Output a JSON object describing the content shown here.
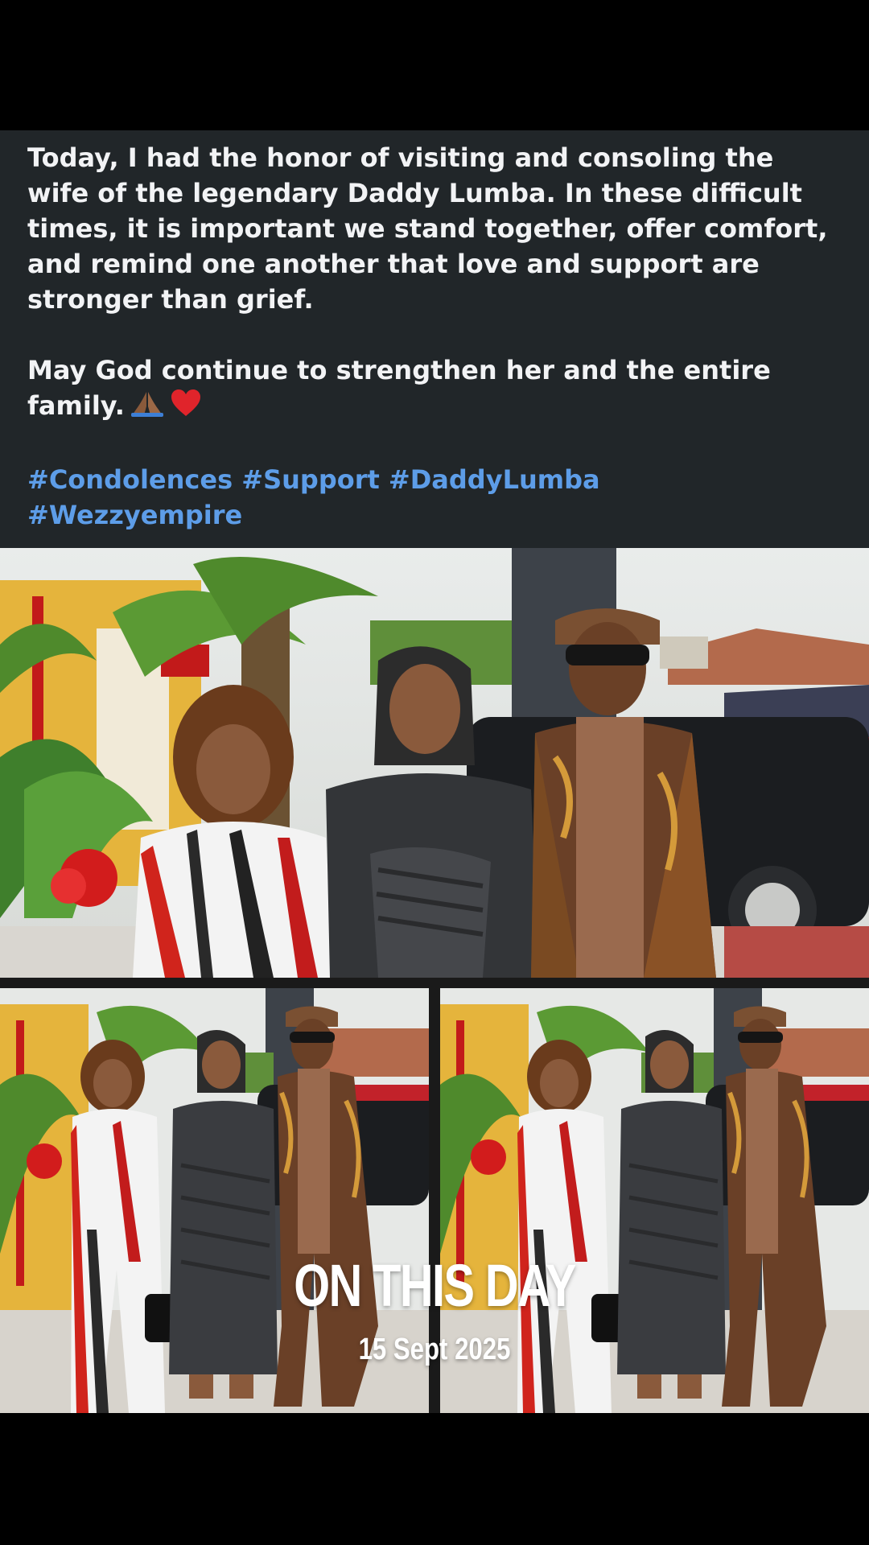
{
  "post": {
    "paragraph1": "Today, I had the honor of visiting and consoling the wife of the legendary Daddy Lumba. In these difficult times, it is important we stand together, offer comfort, and remind one another that love and support are stronger than grief.",
    "paragraph2": "May God continue to strengthen her and the entire family.",
    "emojis": [
      "praying-hands",
      "red-heart"
    ],
    "hashtags": [
      "#Condolences",
      "#Support",
      "#DaddyLumba",
      "#Wezzyempire"
    ]
  },
  "overlay": {
    "title": "ON THIS DAY",
    "date": "15 Sept 2025"
  },
  "colors": {
    "background": "#000000",
    "post_background": "#212629",
    "text": "#f2f3f5",
    "hashtag": "#5d9de8"
  }
}
